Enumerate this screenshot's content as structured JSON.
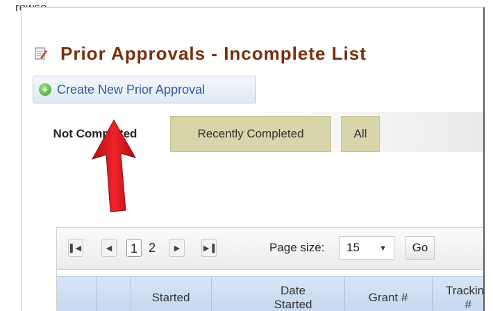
{
  "breadcrumb": "rowse",
  "page": {
    "title": "Prior Approvals - Incomplete List",
    "create_button_label": "Create New Prior Approval"
  },
  "tabs": [
    {
      "label": "Not Completed",
      "active": true
    },
    {
      "label": "Recently Completed",
      "active": false
    },
    {
      "label": "All",
      "active": false
    }
  ],
  "pager": {
    "pages": [
      "1",
      "2"
    ],
    "current_page": "1",
    "page_size_label": "Page size:",
    "page_size_value": "15",
    "go_label": "Go"
  },
  "columns": [
    "",
    "Started",
    "Date Started",
    "Grant #",
    "Tracking #"
  ],
  "colors": {
    "title": "#7a2e0e",
    "button_text": "#2f5c9a",
    "tab_inactive": "#d9d5aa",
    "header_bg": "#c3d6ee",
    "arrow": "#e0141b"
  }
}
